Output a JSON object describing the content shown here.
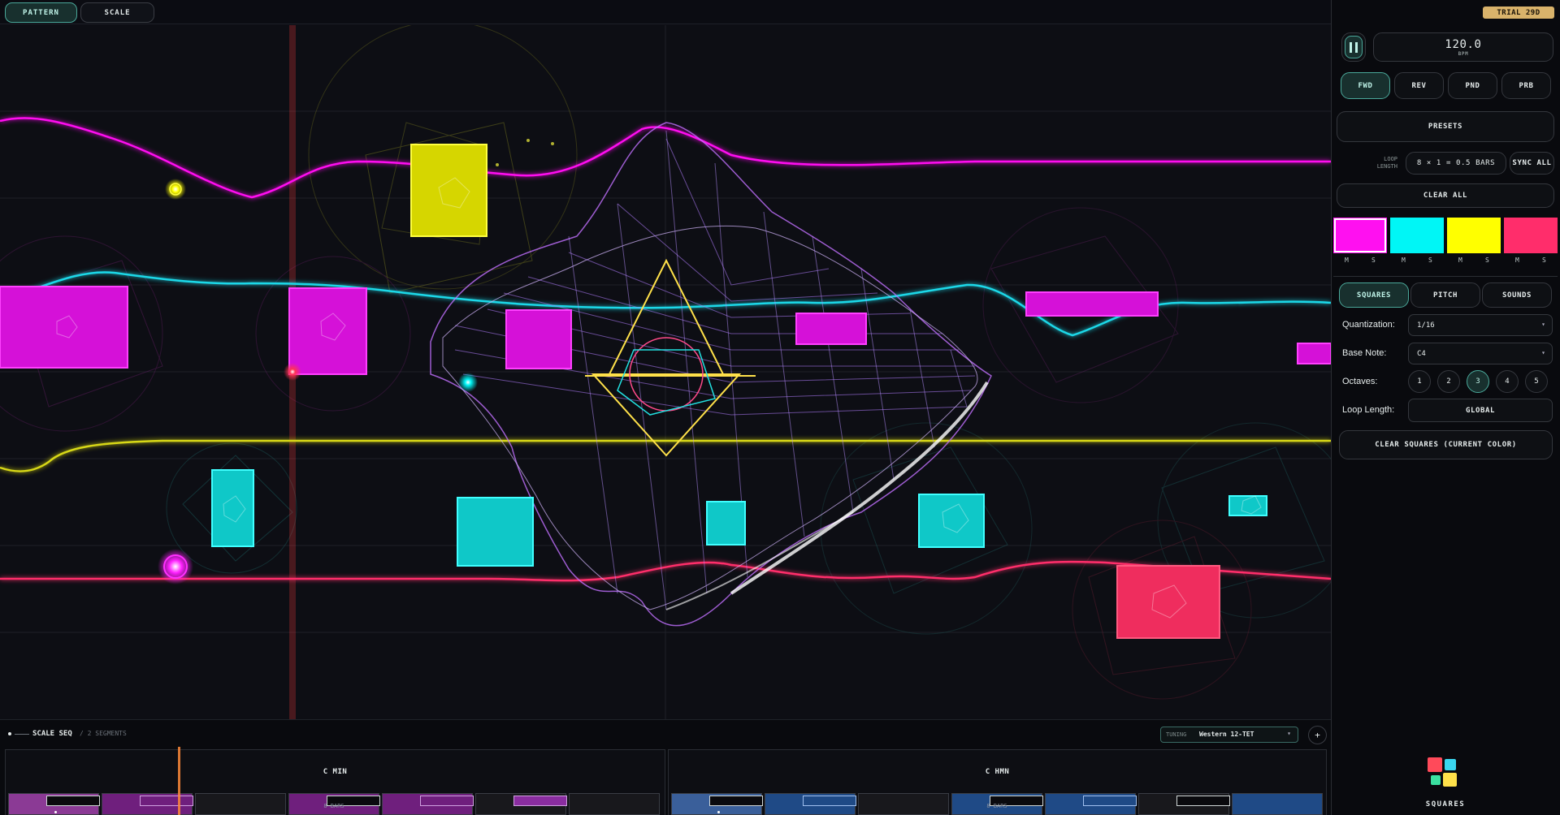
{
  "tabs": {
    "pattern": "PATTERN",
    "scale": "SCALE"
  },
  "trial_badge": "TRIAL 29D",
  "transport": {
    "bpm_value": "120.0",
    "bpm_unit": "BPM"
  },
  "direction_buttons": {
    "fwd": "FWD",
    "rev": "REV",
    "pnd": "PND",
    "prb": "PRB"
  },
  "presets_label": "PRESETS",
  "loop_length": {
    "label_line1": "LOOP",
    "label_line2": "LENGTH",
    "value": "8 × 1 = 0.5 BARS"
  },
  "sync_all_label": "SYNC ALL",
  "clear_all_label": "CLEAR ALL",
  "colors": {
    "magenta": "#ff10f0",
    "cyan": "#00f6f6",
    "yellow": "#ffff00",
    "red": "#ff2d6b",
    "accent": "#4aa89a"
  },
  "swatch_ms": [
    "M",
    "S",
    "M",
    "S",
    "M",
    "S",
    "M",
    "S"
  ],
  "mode_tabs": {
    "squares": "SQUARES",
    "pitch": "PITCH",
    "sounds": "SOUNDS"
  },
  "settings": {
    "quantization_label": "Quantization:",
    "quantization_value": "1/16",
    "base_note_label": "Base Note:",
    "base_note_value": "C4",
    "octaves_label": "Octaves:",
    "octaves": [
      "1",
      "2",
      "3",
      "4",
      "5"
    ],
    "octaves_selected": "3",
    "loop_length_label": "Loop Length:",
    "loop_length_value": "GLOBAL"
  },
  "clear_squares_label": "CLEAR SQUARES (CURRENT COLOR)",
  "logo_text": "SQUARES",
  "scale_seq": {
    "title": "SCALE SEQ",
    "segments_count": "/ 2 SEGMENTS",
    "tuning_label": "TUNING",
    "tuning_value": "Western 12-TET",
    "add_button": "+",
    "segments": [
      {
        "name": "C MIN",
        "bars": "8 BARS"
      },
      {
        "name": "C HMN",
        "bars": "8 BARS"
      }
    ]
  }
}
